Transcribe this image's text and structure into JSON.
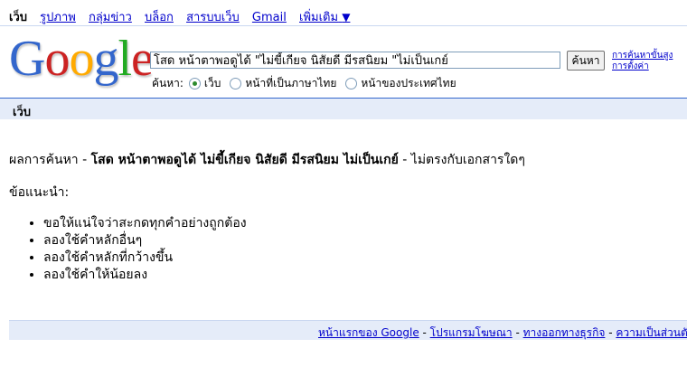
{
  "topnav": {
    "current": "เว็บ",
    "links": [
      "รูปภาพ",
      "กลุ่มข่าว",
      "บล็อก",
      "สารบบเว็บ",
      "Gmail",
      "เพิ่มเติม"
    ],
    "more_arrow": "▼"
  },
  "logo": {
    "letters": [
      "G",
      "o",
      "o",
      "g",
      "l",
      "e"
    ],
    "tm": "™",
    "colors": [
      "#3366cc",
      "#cc2222",
      "#ffaa00",
      "#3366cc",
      "#22aa22",
      "#cc2222"
    ]
  },
  "search": {
    "query": "โสด หน้าตาพอดูได้ \"ไม่ขี้เกียจ นิสัยดี มีรสนิยม \"ไม่เป็นเกย์",
    "button_label": "ค้นหา",
    "adv_search": "การค้นหาขั้นสูง",
    "preferences": "การตั้งค่า"
  },
  "search_scope": {
    "label": "ค้นหา:",
    "options": [
      "เว็บ",
      "หน้าที่เป็นภาษาไทย",
      "หน้าของประเทศไทย"
    ],
    "selected": "เว็บ"
  },
  "results_bar": {
    "title": "เว็บ"
  },
  "no_results": {
    "prefix": "ผลการค้นหา - ",
    "query": "โสด หน้าตาพอดูได้ ไม่ขี้เกียจ นิสัยดี มีรสนิยม ไม่เป็นเกย์",
    "suffix": " - ไม่ตรงกับเอกสารใดๆ"
  },
  "suggestions": {
    "title": "ข้อแนะนำ:",
    "items": [
      "ขอให้แน่ใจว่าสะกดทุกคำอย่างถูกต้อง",
      "ลองใช้คำหลักอื่นๆ",
      "ลองใช้คำหลักที่กว้างขึ้น",
      "ลองใช้คำให้น้อยลง"
    ]
  },
  "footer": {
    "links": [
      "หน้าแรกของ Google",
      "โปรแกรมโฆษณา",
      "ทางออกทางธุรกิจ",
      "ความเป็นส่วนตัว"
    ],
    "separator": " - "
  }
}
